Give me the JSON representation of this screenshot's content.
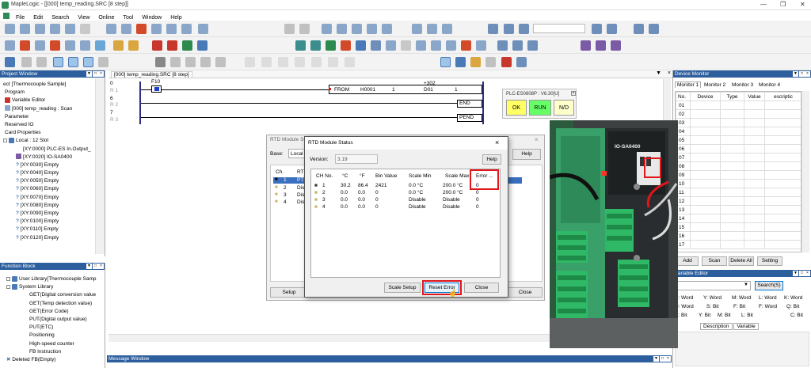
{
  "window": {
    "title": "MapleLogic - [[000] temp_reading.SRC [8 step]]"
  },
  "menu": [
    "File",
    "Edit",
    "Search",
    "View",
    "Online",
    "Tool",
    "Window",
    "Help"
  ],
  "ladder_tab": "[000] temp_reading.SRC [8 step]",
  "project": {
    "title": "Project Window",
    "items": [
      "ect [Thermocouple Sample]",
      "Program",
      "Variable Editor",
      "[000] temp_reading : Scan",
      "Parameter",
      "Reserved IO",
      "Card Properties",
      "Local : 12 Slot",
      "[XY:0000] PLC-ES In.Output_",
      "[XY:0020] IO-SA0400",
      "[XY:0030] Empty",
      "[XY:0040] Empty",
      "[XY:0050] Empty",
      "[XY:0060] Empty",
      "[XY:0070] Empty",
      "[XY:0080] Empty",
      "[XY:0090] Empty",
      "[XY:0100] Empty",
      "[XY:0110] Empty",
      "[XY:0120] Empty"
    ]
  },
  "function_block": {
    "title": "Function Block",
    "items": [
      "User Library[Thermocouple Samp",
      "System Library",
      "GET(Digital conversion value",
      "GET(Temp detection value)",
      "GET(Error Code)",
      "PUT(Digital output value)",
      "PUT(ETC)",
      "Positioning",
      "High-speed counter",
      "FB Instruction",
      "Deleted FB(Empty)"
    ]
  },
  "ladder": {
    "steps": [
      "0",
      "6",
      "7"
    ],
    "rungs": [
      "R 1",
      "R 2",
      "R 3"
    ],
    "contact": "F10",
    "from": "FROM",
    "h0001": "H0001",
    "one": "1",
    "plus302": "+302",
    "d01": "D01",
    "one2": "1",
    "end": "END",
    "pend": "PEND"
  },
  "plc_status": {
    "model": "PLC-ES0808P : V6.30[U]",
    "ok": "OK",
    "run": "RUN",
    "nd": "N/D"
  },
  "rtd_setup": {
    "title": "RTD Module Setup",
    "base_label": "Base:",
    "base_value": "Local",
    "ch_col": "Ch.",
    "rtd_col": "RTD",
    "rows": [
      {
        "ch": "1",
        "rtd": "PT10"
      },
      {
        "ch": "2",
        "rtd": "Disab"
      },
      {
        "ch": "3",
        "rtd": "Disab"
      },
      {
        "ch": "4",
        "rtd": "Disab"
      }
    ],
    "help": "Help",
    "setup": "Setup",
    "close": "Close"
  },
  "rtd_status": {
    "title": "RTD Module Status",
    "version_label": "Version:",
    "version": "3.19",
    "help": "Help",
    "columns": [
      "CH No.",
      "°C",
      "°F",
      "Bin Value",
      "Scale Min",
      "Scale Max",
      "Error ..."
    ],
    "rows": [
      [
        "1",
        "30.2",
        "86.4",
        "2421",
        "0.0 °C",
        "200.0 °C",
        "0"
      ],
      [
        "2",
        "0.0",
        "0.0",
        "0",
        "0.0 °C",
        "200.0 °C",
        "0"
      ],
      [
        "3",
        "0.0",
        "0.0",
        "0",
        "Disable",
        "Disable",
        "0"
      ],
      [
        "4",
        "0.0",
        "0.0",
        "0",
        "Disable",
        "Disable",
        "0"
      ]
    ],
    "scale_setup": "Scale Setup",
    "reset_error": "Reset Error",
    "close": "Close"
  },
  "device_monitor": {
    "title": "Device Monitor",
    "tabs": [
      "Monitor 1",
      "Monitor 2",
      "Monitor 3",
      "Monitor 4"
    ],
    "columns": [
      "No.",
      "Device",
      "Type",
      "Value",
      "escriptic"
    ],
    "rows": [
      "01",
      "02",
      "03",
      "04",
      "05",
      "06",
      "07",
      "08",
      "09",
      "10",
      "11",
      "12",
      "13",
      "14",
      "15",
      "16",
      "17"
    ],
    "add": "Add",
    "scan": "Scan",
    "delete_all": "Delete All",
    "setting": "Setting"
  },
  "variable_editor": {
    "title": "Variable Editor",
    "search": "Search(S)",
    "cells": [
      [
        "X: Word",
        "Y: Word",
        "M: Word",
        "L: Word",
        "K: Word"
      ],
      [
        "D: Word",
        "S: Bit",
        "F: Bit",
        "F: Word",
        "Q: Bit"
      ],
      [
        "X: Bit",
        "Y: Bit",
        "M: Bit",
        "L: Bit",
        "C: Bit"
      ]
    ],
    "tabs": [
      "Description",
      "Variable"
    ]
  },
  "message_window": {
    "title": "Message Window"
  },
  "photo": {
    "module_label": "IO-SA0400"
  },
  "colors": {
    "panel_header": "#2d5f9e",
    "highlight_red": "#e0161b",
    "ok_yellow": "#ffff66",
    "run_green": "#66ff66"
  }
}
